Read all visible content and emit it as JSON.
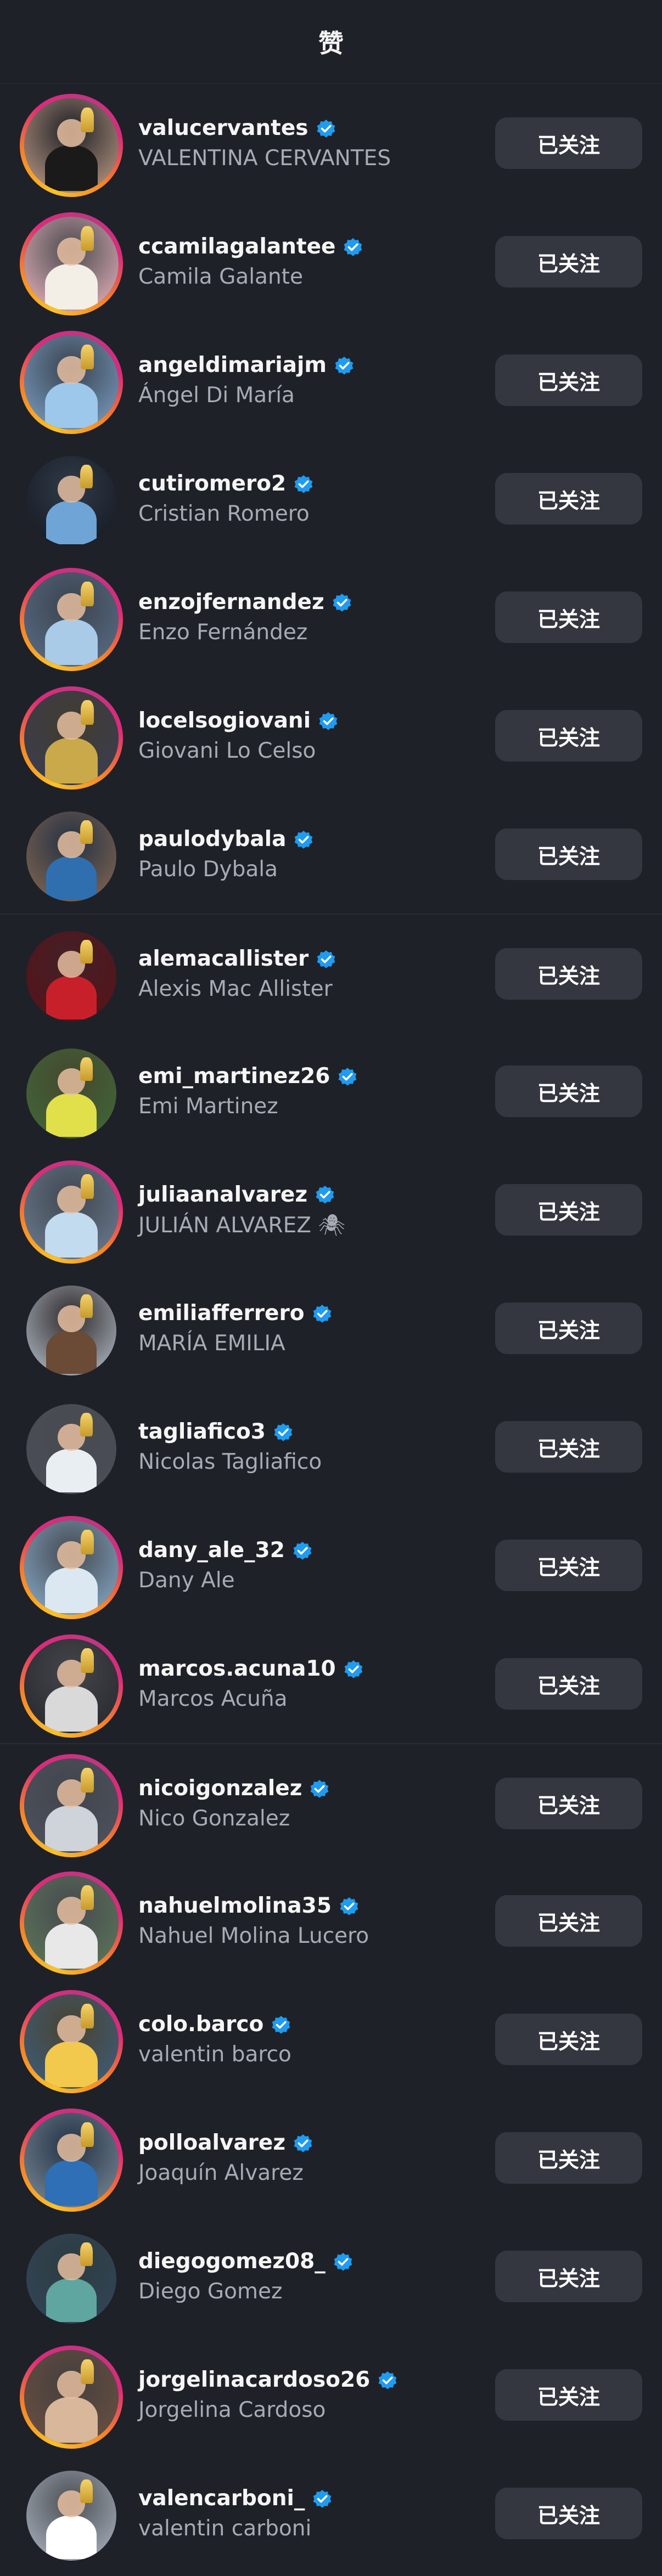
{
  "header": {
    "title": "赞"
  },
  "icons": {
    "verified": "verified-badge-icon"
  },
  "colors": {
    "background": "#1f2128",
    "button": "#343740",
    "verified": "#1f9bf0",
    "secondary_text": "#a7abb3"
  },
  "users": [
    {
      "username": "valucervantes",
      "fullname": "VALENTINA CERVANTES",
      "verified": true,
      "story": true,
      "button": "已关注",
      "avatar_bg": "#c7a38c",
      "avatar_fg": "#1a1a1a"
    },
    {
      "username": "ccamilagalantee",
      "fullname": "Camila Galante",
      "verified": true,
      "story": true,
      "button": "已关注",
      "avatar_bg": "#f0b9c4",
      "avatar_fg": "#f4efe6"
    },
    {
      "username": "angeldimariajm",
      "fullname": "Ángel Di María",
      "verified": true,
      "story": true,
      "button": "已关注",
      "avatar_bg": "#7fa3c9",
      "avatar_fg": "#9dc8ec"
    },
    {
      "username": "cutiromero2",
      "fullname": "Cristian Romero",
      "verified": true,
      "story": false,
      "button": "已关注",
      "avatar_bg": "#14161c",
      "avatar_fg": "#6fa4d6"
    },
    {
      "username": "enzojfernandez",
      "fullname": "Enzo Fernández",
      "verified": true,
      "story": true,
      "button": "已关注",
      "avatar_bg": "#5b6f8a",
      "avatar_fg": "#a9cbe8"
    },
    {
      "username": "locelsogiovani",
      "fullname": "Giovani Lo Celso",
      "verified": true,
      "story": true,
      "button": "已关注",
      "avatar_bg": "#3a3d55",
      "avatar_fg": "#c9a94a"
    },
    {
      "username": "paulodybala",
      "fullname": "Paulo Dybala",
      "verified": true,
      "story": false,
      "button": "已关注",
      "avatar_bg": "#8a6a52",
      "avatar_fg": "#2f6fb0"
    },
    {
      "username": "alemacallister",
      "fullname": "Alexis Mac Allister",
      "verified": true,
      "story": false,
      "button": "已关注",
      "avatar_bg": "#5a1116",
      "avatar_fg": "#c8202b"
    },
    {
      "username": "emi_martinez26",
      "fullname": "Emi Martinez",
      "verified": true,
      "story": false,
      "button": "已关注",
      "avatar_bg": "#3f6a3a",
      "avatar_fg": "#e1e04a"
    },
    {
      "username": "juliaanalvarez",
      "fullname": "JULIÁN ALVAREZ 🕷",
      "verified": true,
      "story": true,
      "button": "已关注",
      "avatar_bg": "#6d7f94",
      "avatar_fg": "#c3dbef"
    },
    {
      "username": "emiliafferrero",
      "fullname": "MARÍA EMILIA",
      "verified": true,
      "story": false,
      "button": "已关注",
      "avatar_bg": "#b9c4cf",
      "avatar_fg": "#6b4a36"
    },
    {
      "username": "tagliafico3",
      "fullname": "Nicolas Tagliafico",
      "verified": true,
      "story": false,
      "button": "已关注",
      "avatar_bg": "#4a4e56",
      "avatar_fg": "#e9eef2"
    },
    {
      "username": "dany_ale_32",
      "fullname": "Dany Ale",
      "verified": true,
      "story": true,
      "button": "已关注",
      "avatar_bg": "#8ab0cf",
      "avatar_fg": "#dbe8f2"
    },
    {
      "username": "marcos.acuna10",
      "fullname": "Marcos Acuña",
      "verified": true,
      "story": true,
      "button": "已关注",
      "avatar_bg": "#24262c",
      "avatar_fg": "#d9d9d9"
    },
    {
      "username": "nicoigonzalez",
      "fullname": "Nico Gonzalez",
      "verified": true,
      "story": true,
      "button": "已关注",
      "avatar_bg": "#4d5360",
      "avatar_fg": "#cfd3da"
    },
    {
      "username": "nahuelmolina35",
      "fullname": "Nahuel Molina Lucero",
      "verified": true,
      "story": true,
      "button": "已关注",
      "avatar_bg": "#5d7a5a",
      "avatar_fg": "#e8e8e8"
    },
    {
      "username": "colo.barco",
      "fullname": "valentin barco",
      "verified": true,
      "story": true,
      "button": "已关注",
      "avatar_bg": "#3c5f83",
      "avatar_fg": "#f2c94c"
    },
    {
      "username": "polloalvarez",
      "fullname": "Joaquín Alvarez",
      "verified": true,
      "story": true,
      "button": "已关注",
      "avatar_bg": "#7e8f9c",
      "avatar_fg": "#2e6fb5"
    },
    {
      "username": "diegogomez08_",
      "fullname": "Diego Gomez",
      "verified": true,
      "story": false,
      "button": "已关注",
      "avatar_bg": "#33465a",
      "avatar_fg": "#5fa6a0"
    },
    {
      "username": "jorgelinacardoso26",
      "fullname": "Jorgelina Cardoso",
      "verified": true,
      "story": true,
      "button": "已关注",
      "avatar_bg": "#6e5140",
      "avatar_fg": "#d9b79a"
    },
    {
      "username": "valencarboni_",
      "fullname": "valentin carboni",
      "verified": true,
      "story": false,
      "button": "已关注",
      "avatar_bg": "#aeb9c6",
      "avatar_fg": "#ffffff"
    }
  ]
}
